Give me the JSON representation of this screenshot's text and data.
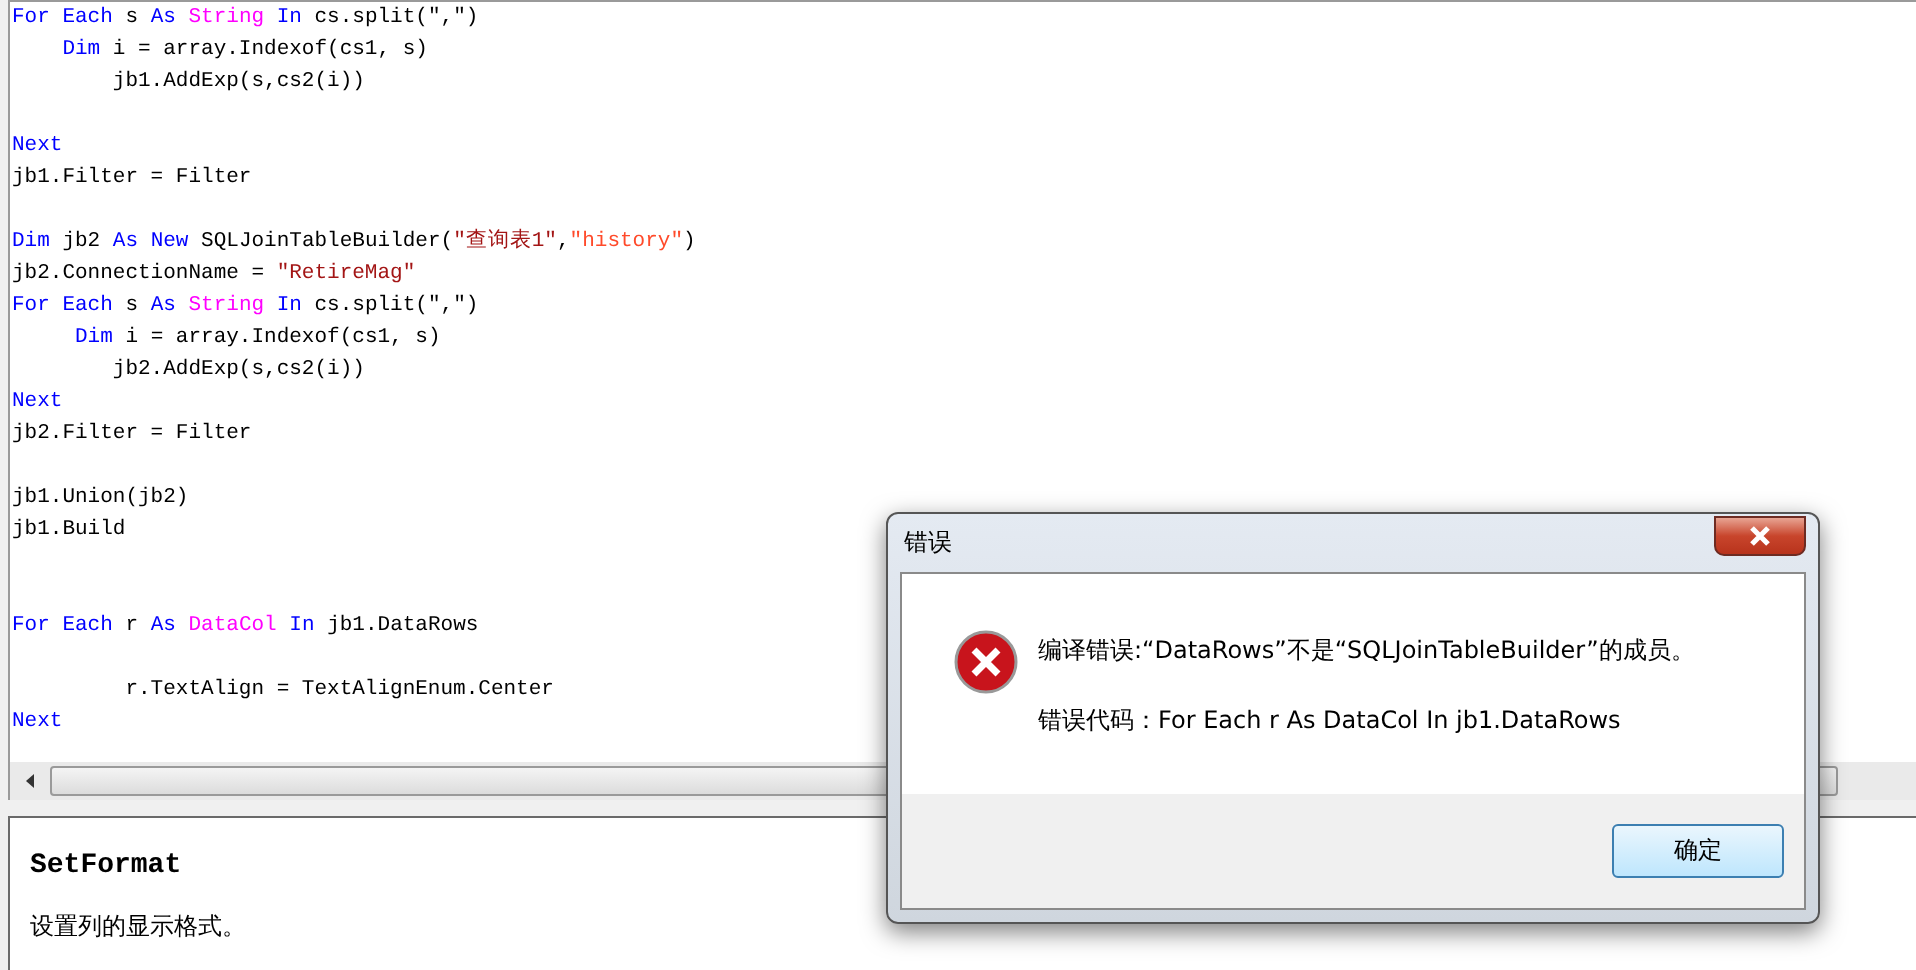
{
  "editor": {
    "lines": [
      {
        "tokens": [
          {
            "text": "For",
            "kind": "keyword"
          },
          {
            "text": " Each",
            "kind": "keyword"
          },
          {
            "text": " s "
          },
          {
            "text": "As",
            "kind": "keyword"
          },
          {
            "text": " String",
            "kind": "type"
          },
          {
            "text": " In",
            "kind": "keyword"
          },
          {
            "text": " cs.split(\",\")"
          }
        ]
      },
      {
        "tokens": [
          {
            "text": "    Dim",
            "kind": "keyword"
          },
          {
            "text": " i = array.Indexof(cs1, s)"
          }
        ]
      },
      {
        "tokens": [
          {
            "text": "        jb1.AddExp(s,cs2(i))"
          }
        ]
      },
      {
        "blank_before": true,
        "tokens": [
          {
            "text": "Next",
            "kind": "keyword"
          }
        ]
      },
      {
        "tokens": [
          {
            "text": "jb1.Filter = Filter"
          }
        ]
      },
      {
        "blank_before": true,
        "tokens": [
          {
            "text": "Dim",
            "kind": "keyword"
          },
          {
            "text": " jb2 "
          },
          {
            "text": "As",
            "kind": "keyword"
          },
          {
            "text": " New",
            "kind": "keyword"
          },
          {
            "text": " SQLJoinTableBuilder("
          },
          {
            "text": "\"查询表1\"",
            "kind": "string"
          },
          {
            "text": ","
          },
          {
            "text": "\"history\"",
            "kind": "string2"
          },
          {
            "text": ")"
          }
        ]
      },
      {
        "tokens": [
          {
            "text": "jb2.ConnectionName = "
          },
          {
            "text": "\"RetireMag\"",
            "kind": "string"
          }
        ]
      },
      {
        "tokens": [
          {
            "text": "For",
            "kind": "keyword"
          },
          {
            "text": " Each",
            "kind": "keyword"
          },
          {
            "text": " s "
          },
          {
            "text": "As",
            "kind": "keyword"
          },
          {
            "text": " String",
            "kind": "type"
          },
          {
            "text": " In",
            "kind": "keyword"
          },
          {
            "text": " cs.split(\",\")"
          }
        ]
      },
      {
        "tokens": [
          {
            "text": "     Dim",
            "kind": "keyword"
          },
          {
            "text": " i = array.Indexof(cs1, s)"
          }
        ]
      },
      {
        "tokens": [
          {
            "text": "        jb2.AddExp(s,cs2(i))"
          }
        ]
      },
      {
        "tokens": [
          {
            "text": "Next",
            "kind": "keyword"
          }
        ]
      },
      {
        "tokens": [
          {
            "text": "jb2.Filter = Filter"
          }
        ]
      },
      {
        "blank_before": true,
        "tokens": [
          {
            "text": "jb1.Union(jb2)"
          }
        ]
      },
      {
        "tokens": [
          {
            "text": "jb1.Build"
          }
        ]
      },
      {
        "blank_before": true,
        "extra_blank": true,
        "tokens": [
          {
            "text": "For",
            "kind": "keyword"
          },
          {
            "text": " Each",
            "kind": "keyword"
          },
          {
            "text": " r "
          },
          {
            "text": "As",
            "kind": "keyword"
          },
          {
            "text": " DataCol",
            "kind": "type"
          },
          {
            "text": " In",
            "kind": "keyword"
          },
          {
            "text": " jb1.DataRows"
          }
        ]
      },
      {
        "blank_before": true,
        "tokens": [
          {
            "text": "         r.TextAlign = TextAlignEnum.Center"
          }
        ]
      },
      {
        "tokens": [
          {
            "text": "Next",
            "kind": "keyword"
          }
        ]
      }
    ]
  },
  "help": {
    "title": "SetFormat",
    "description": "设置列的显示格式。"
  },
  "dialog": {
    "title": "错误",
    "message": "编译错误:“DataRows”不是“SQLJoinTableBuilder”的成员。",
    "detail": "错误代码：For Each r As DataCol In jb1.DataRows",
    "button": "确定"
  }
}
